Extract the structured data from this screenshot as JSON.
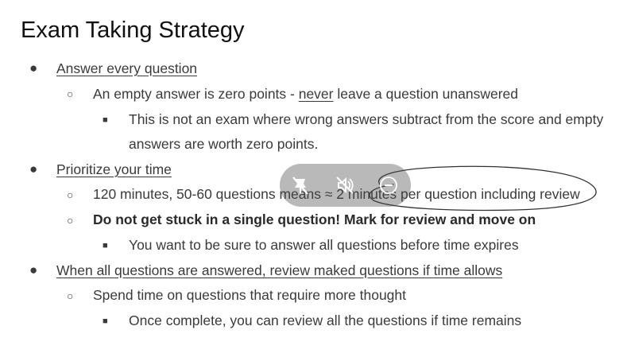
{
  "title": "Exam Taking Strategy",
  "sections": [
    {
      "heading": "Answer every question",
      "sub": {
        "pre": "An empty answer is zero points - ",
        "emph": "never",
        "post": " leave a question unanswered",
        "detail_line1": "This is not an exam where wrong answers subtract from the score and empty",
        "detail_line2": "answers are worth zero points."
      }
    },
    {
      "heading": "Prioritize your time",
      "sub1": "120 minutes, 50-60 questions means ≈ 2 minutes per question including review",
      "sub2": "Do not get stuck in a single question! Mark for review and move on",
      "detail": "You want to be sure to answer all questions before time expires"
    },
    {
      "heading": "When all questions are answered, review maked questions if time allows",
      "sub": "Spend time on questions that require more thought",
      "detail": "Once complete, you can review all the questions if time remains"
    }
  ],
  "overlay": {
    "buttons": [
      "pin-off-icon",
      "audio-off-icon",
      "minus-circle-icon"
    ]
  }
}
